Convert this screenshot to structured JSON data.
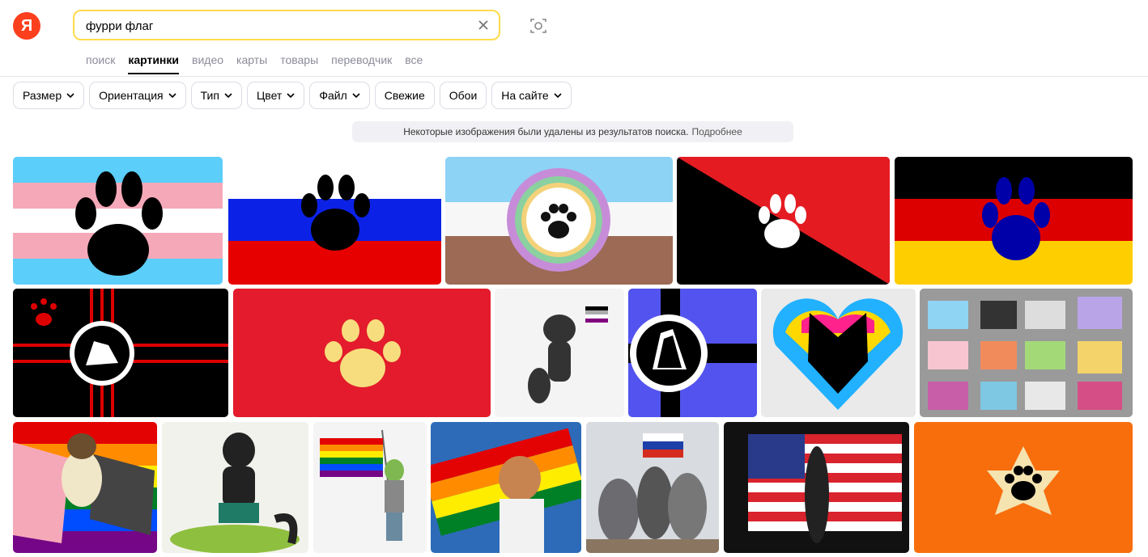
{
  "header": {
    "logo_text": "Я",
    "search": {
      "value": "фурри флаг"
    },
    "tabs": [
      {
        "label": "поиск"
      },
      {
        "label": "картинки",
        "active": true
      },
      {
        "label": "видео"
      },
      {
        "label": "карты"
      },
      {
        "label": "товары"
      },
      {
        "label": "переводчик"
      },
      {
        "label": "все"
      }
    ]
  },
  "filters": [
    {
      "label": "Размер",
      "dropdown": true
    },
    {
      "label": "Ориентация",
      "dropdown": true
    },
    {
      "label": "Тип",
      "dropdown": true
    },
    {
      "label": "Цвет",
      "dropdown": true
    },
    {
      "label": "Файл",
      "dropdown": true
    },
    {
      "label": "Свежие",
      "dropdown": false
    },
    {
      "label": "Обои",
      "dropdown": false
    },
    {
      "label": "На сайте",
      "dropdown": true
    }
  ],
  "notice": {
    "text": "Некоторые изображения были удалены из результатов поиска.",
    "link": "Подробнее"
  },
  "results": [
    {
      "label": "trans-paw-flag"
    },
    {
      "label": "russian-paw-flag"
    },
    {
      "label": "rainbow-circle-paw-flag"
    },
    {
      "label": "red-black-paw-flag"
    },
    {
      "label": "german-paw-flag"
    },
    {
      "label": "black-red-wolf-flag"
    },
    {
      "label": "red-yellow-paw-flag"
    },
    {
      "label": "asexual-flag-wolf"
    },
    {
      "label": "blue-wolf-cross-flag"
    },
    {
      "label": "pan-wolf-heart"
    },
    {
      "label": "pride-sticker-sheet"
    },
    {
      "label": "ferret-pride-flags"
    },
    {
      "label": "dog-with-leash"
    },
    {
      "label": "wolf-rainbow-flag"
    },
    {
      "label": "fox-russia-2018"
    },
    {
      "label": "furries-with-russian-flag"
    },
    {
      "label": "usa-flag-wolf"
    },
    {
      "label": "orange-paw-star-flag"
    }
  ],
  "colors": {
    "accent": "#ffdb4d",
    "logo": "#fc3f1d"
  }
}
